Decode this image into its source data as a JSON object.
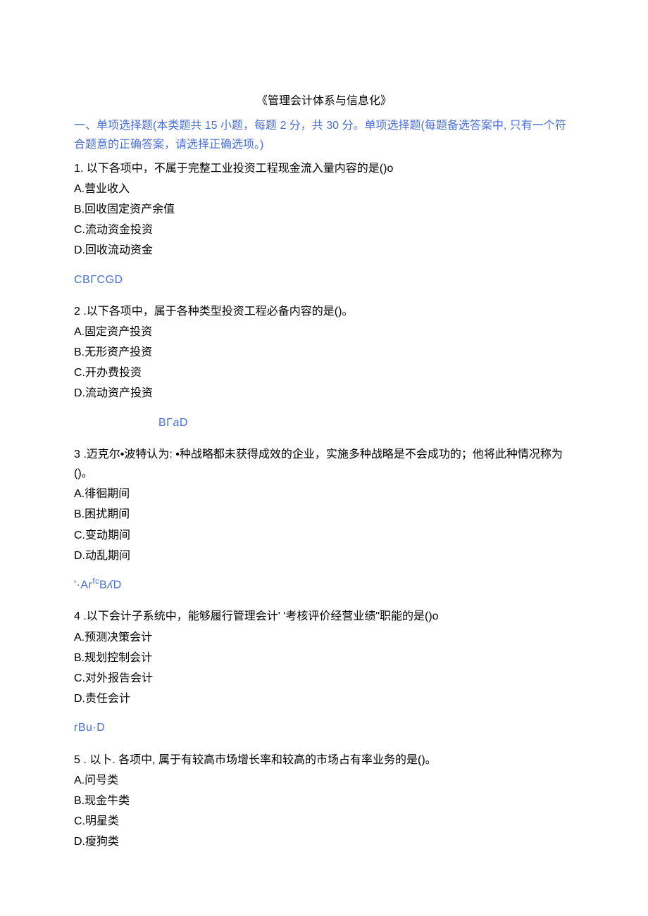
{
  "title": "《管理会计体系与信息化》",
  "instructions": "一、单项选择题(本类题共 15 小题，每题 2 分，共 30 分。单项选择题(每题备选答案中, 只有一个符合题意的正确答案，请选择正确选项。)",
  "questions": [
    {
      "stem": "1. 以下各项中，不属于完整工业投资工程现金流入量内容的是()o",
      "options": {
        "A": "A.营业收入",
        "B": "B.回收固定资产余值",
        "C": "C.流动资金投资",
        "D": "D.回收流动资金"
      },
      "answer_display": "CBΓCGD"
    },
    {
      "stem": "2 .以下各项中，属于各种类型投资工程必备内容的是()。",
      "options": {
        "A": "A.固定资产投资",
        "B": "B.无形资产投资",
        "C": "C.开办费投资",
        "D": "D.流动资产投资"
      },
      "answer_display_parts": [
        "BΓ",
        "a",
        "D"
      ],
      "answer_indent": true
    },
    {
      "stem": "3 .迈克尔•波特认为: •种战略都未获得成效的企业，实施多种战略是不会成功的；他将此种情况称为()。",
      "options": {
        "A": "A.徘徊期间",
        "B": "B.困扰期间",
        "C": "C.变动期间",
        "D": "D.动乱期间"
      },
      "answer_display_parts": [
        "'·Ar",
        "fc",
        "B",
        "ʎ",
        "D"
      ]
    },
    {
      "stem": "4 .以下会计子系统中，能够履行管理会计' '考核评价经营业绩\"职能的是()o",
      "options": {
        "A": "A.预测决策会计",
        "B": "B.规划控制会计",
        "C": "C.对外报告会计",
        "D": "D.责任会计"
      },
      "answer_display": "rBu·D"
    },
    {
      "stem": "5 . 以卜. 各项中, 属于有较高市场增长率和较高的市场占有率业务的是()。",
      "options": {
        "A": "A.问号类",
        "B": "B.现金牛类",
        "C": "C.明星类",
        "D": "D.瘦狗类"
      }
    }
  ]
}
